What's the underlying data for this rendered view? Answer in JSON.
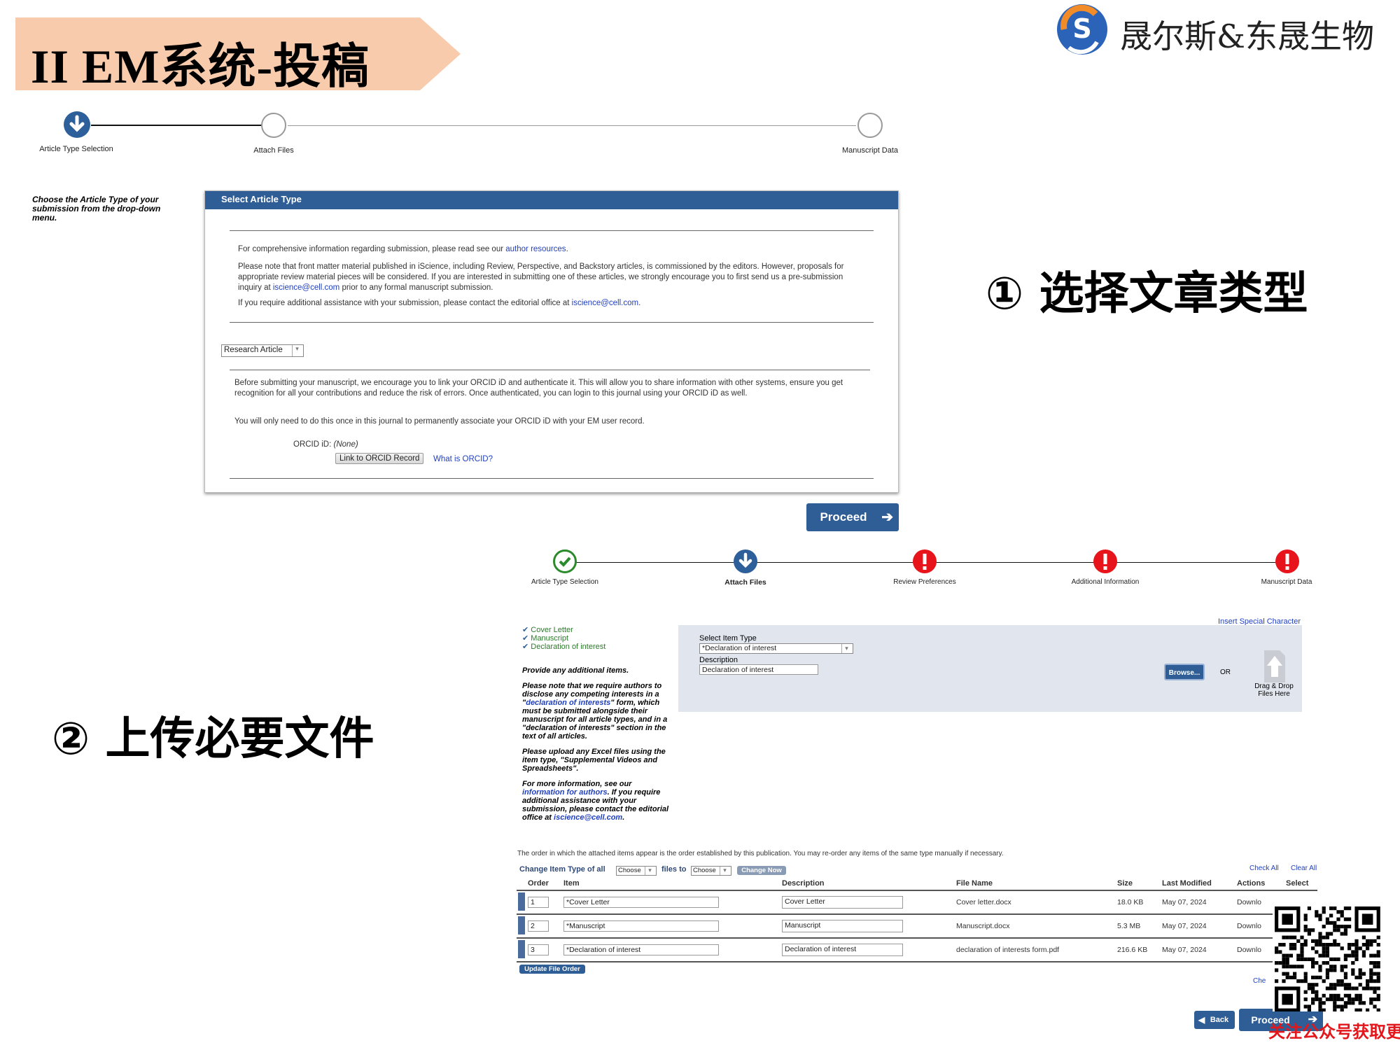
{
  "banner": {
    "title": "II EM系统-投稿",
    "color": "#f8cbad"
  },
  "logo": {
    "text": "晟尔斯&东晟生物"
  },
  "stepper1": {
    "steps": [
      {
        "label": "Article Type Selection",
        "state": "current"
      },
      {
        "label": "Attach Files",
        "state": "pending"
      },
      {
        "label": "Manuscript Data",
        "state": "pending"
      }
    ]
  },
  "left_instruction": "Choose the Article Type of your submission from the drop-down menu.",
  "select_article_panel": {
    "header": "Select Article Type",
    "p1_pre": "For comprehensive information regarding submission, please read see our ",
    "p1_link": "author resources",
    "p1_post": ".",
    "p2_pre": "Please note that front matter material published in iScience, including Review, Perspective, and Backstory articles, is commissioned by the editors. However, proposals for appropriate review material pieces will be considered. If you are interested in submitting one of these articles, we strongly encourage you to first send us a pre-submission inquiry at ",
    "p2_link": "iscience@cell.com",
    "p2_post": " prior to any formal manuscript submission.",
    "p3_pre": "If you require additional assistance with your submission, please contact the editorial office at ",
    "p3_link": "iscience@cell.com",
    "p3_post": ".",
    "article_type_value": "Research Article",
    "orcid_p1": "Before submitting your manuscript, we encourage you to link your ORCID iD and authenticate it. This will allow you to share information with other systems, ensure you get recognition for all your contributions and reduce the risk of errors. Once authenticated, you can login to this journal using your ORCID iD as well.",
    "orcid_p2": "You will only need to do this once in this journal to permanently associate your ORCID iD with your EM user record.",
    "orcid_label": "ORCID iD:",
    "orcid_value": "(None)",
    "link_orcid_button": "Link to ORCID Record",
    "what_is_orcid": "What is ORCID?"
  },
  "proceed_button_1": "Proceed",
  "annotation_1": "① 选择文章类型",
  "annotation_2": "② 上传必要文件",
  "stepper2": {
    "steps": [
      {
        "label": "Article Type Selection",
        "state": "done"
      },
      {
        "label": "Attach Files",
        "state": "current"
      },
      {
        "label": "Review Preferences",
        "state": "error"
      },
      {
        "label": "Additional Information",
        "state": "error"
      },
      {
        "label": "Manuscript Data",
        "state": "error"
      }
    ]
  },
  "checklist": [
    "Cover Letter",
    "Manuscript",
    "Declaration of interest"
  ],
  "left_help": {
    "h1": "Provide any additional items.",
    "p1_pre": "Please note that we require authors to disclose any competing interests in a \"",
    "p1_link": "declaration of interests",
    "p1_post": "\" form, which must be submitted alongside their manuscript for all article types, and in a \"declaration of interests\" section in the text of all articles.",
    "p2": "Please upload any Excel files using the item type, \"Supplemental Videos and Spreadsheets\".",
    "p3_pre": "For more information, see our ",
    "p3_link": "information for authors",
    "p3_mid": ". If you require additional assistance with your submission, please contact the editorial office at ",
    "p3_link2": "iscience@cell.com",
    "p3_post": "."
  },
  "upload": {
    "insert_special": "Insert Special Character",
    "select_item_label": "Select Item Type",
    "select_item_value": "*Declaration of interest",
    "description_label": "Description",
    "description_value": "Declaration of interest",
    "browse_button": "Browse...",
    "or_text": "OR",
    "drag_drop": "Drag & Drop Files Here"
  },
  "order_note": "The order in which the attached items appear is the order established by this publication. You may re-order any items of the same type manually if necessary.",
  "change_row": {
    "label1": "Change Item Type of all",
    "choose1": "Choose",
    "label2": "files to",
    "choose2": "Choose",
    "change_now": "Change Now",
    "check_all": "Check All",
    "clear_all": "Clear All"
  },
  "files_table": {
    "headers": [
      "Order",
      "Item",
      "Description",
      "File Name",
      "Size",
      "Last Modified",
      "Actions",
      "Select"
    ],
    "rows": [
      {
        "order": "1",
        "item": "*Cover Letter",
        "description": "Cover Letter",
        "file": "Cover letter.docx",
        "size": "18.0 KB",
        "modified": "May 07, 2024",
        "action": "Downlo"
      },
      {
        "order": "2",
        "item": "*Manuscript",
        "description": "Manuscript",
        "file": "Manuscript.docx",
        "size": "5.3 MB",
        "modified": "May 07, 2024",
        "action": "Downlo"
      },
      {
        "order": "3",
        "item": "*Declaration of interest",
        "description": "Declaration of interest",
        "file": "declaration of interests form.pdf",
        "size": "216.6 KB",
        "modified": "May 07, 2024",
        "action": "Downlo"
      }
    ],
    "update_order_button": "Update File Order",
    "check_partial": "Che"
  },
  "back_button": "Back",
  "proceed_button_2": "Proceed",
  "qr_caption": "关注公众号获取更多资讯"
}
